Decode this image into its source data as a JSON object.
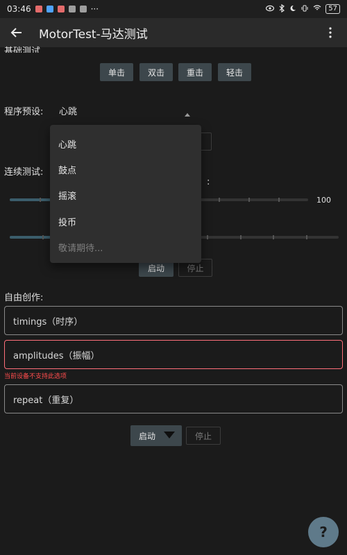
{
  "statusbar": {
    "time": "03:46",
    "more": "···",
    "battery": "57"
  },
  "appbar": {
    "title": "MotorTest-马达测试"
  },
  "top_section_label": "基础测试",
  "tap_buttons": [
    "单击",
    "双击",
    "重击",
    "轻击"
  ],
  "preset": {
    "label": "程序预设:",
    "selected": "心跳",
    "options": [
      "心跳",
      "鼓点",
      "摇滚",
      "投币",
      "敬请期待..."
    ]
  },
  "continuous": {
    "label": "连续测试:",
    "colon": ":",
    "slider_max_label": "100",
    "slider1_fraction": 0.2,
    "slider2_fraction": 0.2,
    "start_label": "启动",
    "stop_label": "停止"
  },
  "free_creation": {
    "label": "自由创作:",
    "timings_placeholder": "timings（时序）",
    "amplitudes_placeholder": "amplitudes（振幅）",
    "amplitudes_error": "当前设备不支持此选项",
    "repeat_placeholder": "repeat（重复）",
    "start_label": "启动",
    "stop_label": "停止"
  },
  "fab": {
    "label": "?"
  },
  "colors": {
    "accent": "#3d474c",
    "error": "#ff6f7a",
    "background": "#1b1b1b"
  }
}
